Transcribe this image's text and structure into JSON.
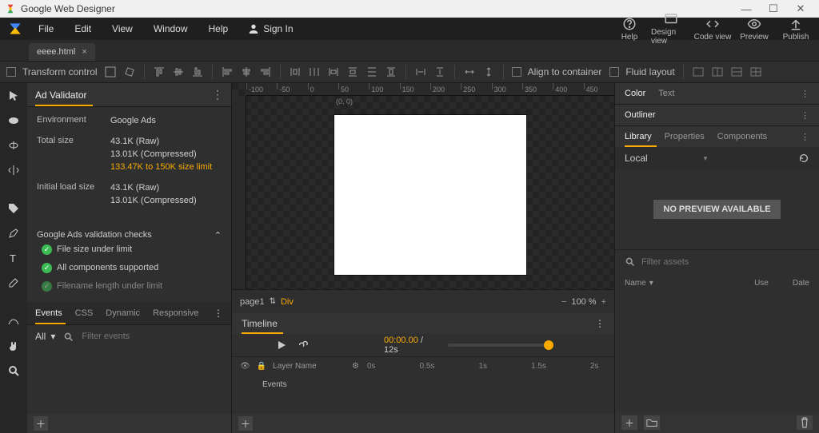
{
  "window": {
    "title": "Google Web Designer"
  },
  "menus": {
    "file": "File",
    "edit": "Edit",
    "view": "View",
    "window": "Window",
    "help": "Help",
    "signin": "Sign In"
  },
  "topbuttons": {
    "help": "Help",
    "design": "Design view",
    "code": "Code view",
    "preview": "Preview",
    "publish": "Publish"
  },
  "file_tab": {
    "name": "eeee.html"
  },
  "toolbar": {
    "transform": "Transform control",
    "align_container": "Align to container",
    "fluid": "Fluid layout"
  },
  "ad_validator": {
    "title": "Ad Validator",
    "environment_label": "Environment",
    "environment": "Google Ads",
    "totalsize_label": "Total size",
    "totalsize_raw": "43.1K (Raw)",
    "totalsize_compressed": "13.01K (Compressed)",
    "totalsize_limit": "133.47K to 150K size limit",
    "initload_label": "Initial load size",
    "initload_raw": "43.1K (Raw)",
    "initload_compressed": "13.01K (Compressed)",
    "checks_title": "Google Ads validation checks",
    "check1": "File size under limit",
    "check2": "All components supported",
    "check3": "Filename length under limit"
  },
  "left_lower": {
    "tab_events": "Events",
    "tab_css": "CSS",
    "tab_dynamic": "Dynamic",
    "tab_responsive": "Responsive",
    "filter_all": "All",
    "filter_placeholder": "Filter events"
  },
  "canvas": {
    "origin": "(0, 0)",
    "page": "page1",
    "div": "Div",
    "zoom": "100 %",
    "ruler": [
      "-100",
      "-50",
      "0",
      "50",
      "100",
      "150",
      "200",
      "250",
      "300",
      "350",
      "400",
      "450"
    ]
  },
  "timeline": {
    "title": "Timeline",
    "current": "00:00.00",
    "total": " / 12s",
    "layer_header": "Layer Name",
    "row_events": "Events",
    "ticks": [
      "0s",
      "0.5s",
      "1s",
      "1.5s",
      "2s"
    ]
  },
  "right": {
    "color": "Color",
    "text": "Text",
    "outliner": "Outliner",
    "lib": "Library",
    "props": "Properties",
    "comps": "Components",
    "local": "Local",
    "nopreview": "NO PREVIEW AVAILABLE",
    "filter": "Filter assets",
    "col_name": "Name",
    "col_use": "Use",
    "col_date": "Date"
  }
}
